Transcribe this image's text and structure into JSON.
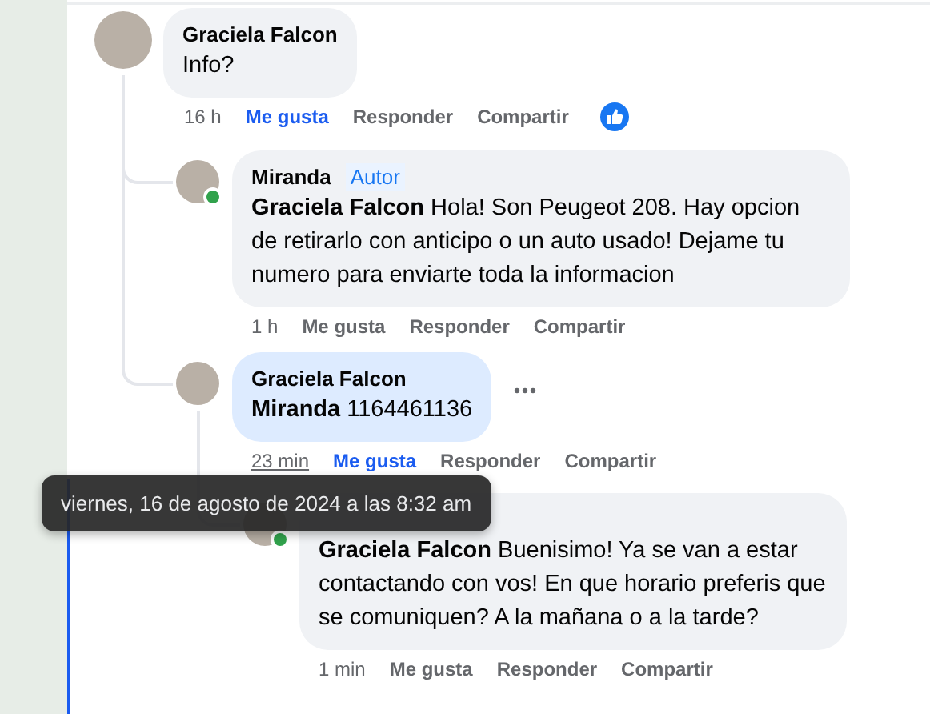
{
  "comments": [
    {
      "author": "Graciela Falcon",
      "text": "Info?",
      "time": "16 h",
      "time_hovered": false,
      "liked": true,
      "actions": [
        "Me gusta",
        "Responder",
        "Compartir"
      ],
      "liked_reaction": true,
      "online": false,
      "highlighted": false,
      "menu_shown": false,
      "children": [
        {
          "author": "Miranda",
          "author_badge": "Autor",
          "text": "**Graciela Falcon** Hola! Son Peugeot 208. Hay opcion de retirarlo con anticipo o un auto usado! Dejame tu numero para enviarte toda la informacion",
          "time": "1 h",
          "time_hovered": false,
          "liked": false,
          "actions": [
            "Me gusta",
            "Responder",
            "Compartir"
          ],
          "online": true,
          "highlighted": false,
          "menu_shown": false
        },
        {
          "author": "Graciela Falcon",
          "text": "**Miranda** 1164461136",
          "time": "23 min",
          "time_hovered": true,
          "liked": true,
          "actions": [
            "Me gusta",
            "Responder",
            "Compartir"
          ],
          "online": false,
          "highlighted": true,
          "menu_shown": true,
          "children": [
            {
              "text": "**Graciela Falcon** Buenisimo! Ya se van a estar contactando con vos! En que horario preferis que se comuniquen? A la mañana o a la tarde?",
              "time": "1 min",
              "time_hovered": false,
              "liked": false,
              "actions": [
                "Me gusta",
                "Responder",
                "Compartir"
              ],
              "online": true,
              "highlighted": false,
              "menu_shown": false
            }
          ]
        }
      ]
    }
  ],
  "tooltip": {
    "text": "viernes, 16 de agosto de 2024 a las 8:32 am"
  }
}
